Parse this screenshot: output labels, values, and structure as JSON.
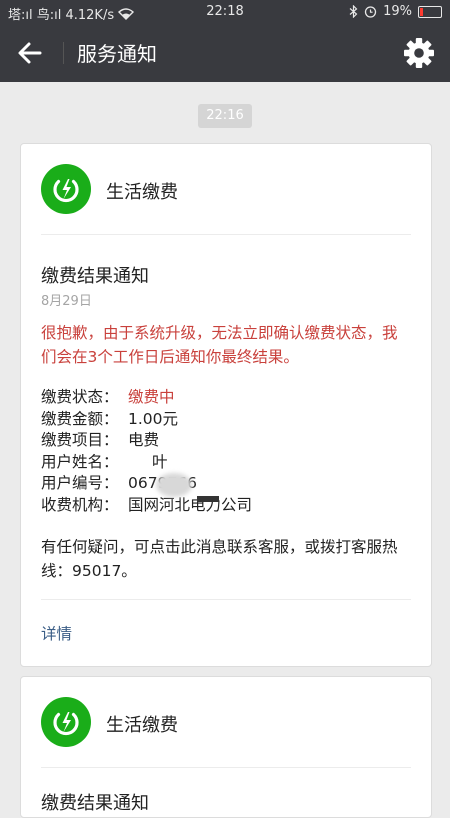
{
  "status_bar": {
    "left_text": "塔:ıl 鸟:ıl 4.12K/s",
    "time": "22:18",
    "battery": "19%",
    "icons": [
      "bluetooth-icon",
      "alarm-icon",
      "wifi-icon",
      "battery-icon"
    ]
  },
  "nav": {
    "title": "服务通知",
    "back_icon": "arrow-left-icon",
    "settings_icon": "gear-icon"
  },
  "timestamp": "22:16",
  "card1": {
    "service_name": "生活缴费",
    "title": "缴费结果通知",
    "date": "8月29日",
    "warning": "很抱歉，由于系统升级，无法立即确认缴费状态，我们会在3个工作日后通知你最终结果。",
    "fields": [
      {
        "label": "缴费状态：",
        "value": "缴费中"
      },
      {
        "label": "缴费金额：",
        "value": "1.00元"
      },
      {
        "label": "缴费项目：",
        "value": "电费"
      },
      {
        "label": "用户姓名：",
        "value": "叶"
      },
      {
        "label": "用户编号：",
        "value": "0679766"
      },
      {
        "label": "收费机构：",
        "value": "国网河北电力公司"
      }
    ],
    "note": "有任何疑问，可点击此消息联系客服，或拨打客服热线：95017。",
    "detail_link": "详情"
  },
  "card2": {
    "service_name": "生活缴费",
    "title": "缴费结果通知"
  },
  "colors": {
    "header_bg": "#393a3f",
    "logo_green": "#1aad19",
    "warning_red": "#c9413c",
    "link_blue": "#3a5d86"
  }
}
